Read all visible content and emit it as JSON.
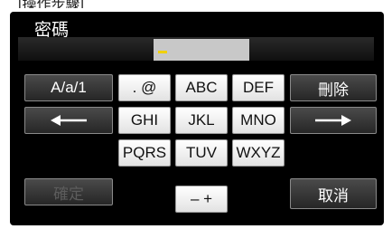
{
  "header_snippet": "[操作步驟]",
  "title": "密碼",
  "input": {
    "value": ""
  },
  "keys": {
    "mode": "A/a/1",
    "symbols": ". @",
    "abc": "ABC",
    "def": "DEF",
    "delete": "刪除",
    "ghi": "GHI",
    "jkl": "JKL",
    "mno": "MNO",
    "pqrs": "PQRS",
    "tuv": "TUV",
    "wxyz": "WXYZ",
    "ok": "確定",
    "plus_minus": "– +",
    "cancel": "取消",
    "left_arrow_icon": "arrow-left-icon",
    "right_arrow_icon": "arrow-right-icon"
  },
  "colors": {
    "panel": "#000000",
    "key_light": "#f2f2f2",
    "key_dark": "#333333",
    "cursor": "#f0d000"
  }
}
